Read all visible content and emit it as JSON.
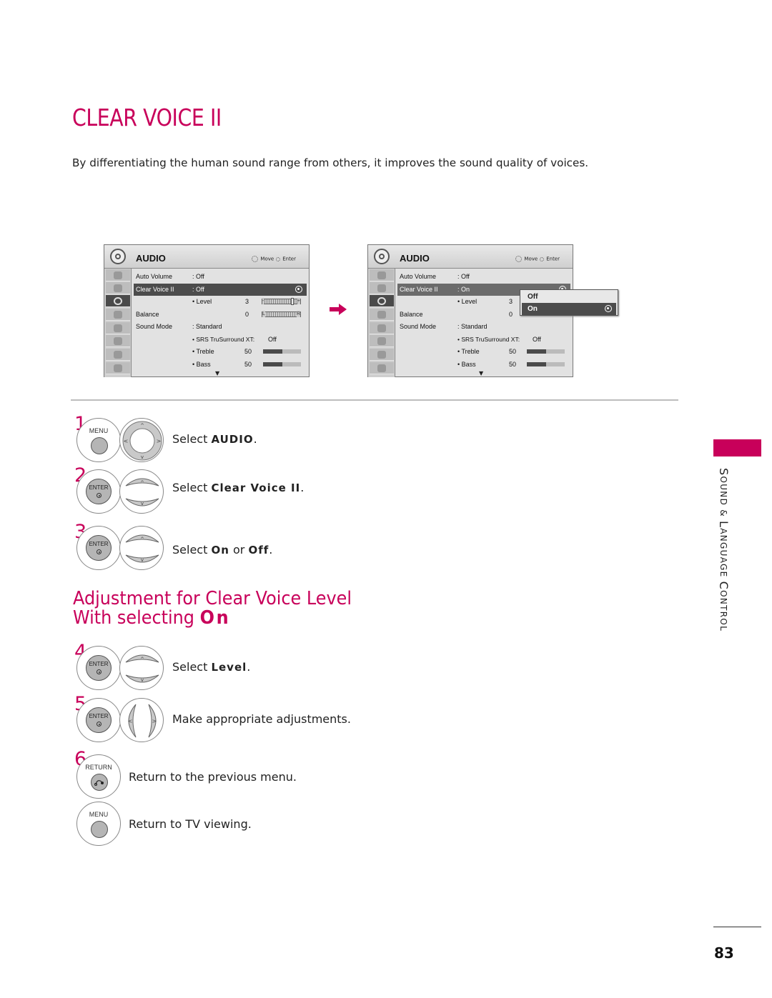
{
  "title": "CLEAR VOICE II",
  "intro": "By differentiating the human sound range from others, it improves the sound quality of voices.",
  "colors": {
    "accent": "#c8005a",
    "osd_highlight": "#4c4c4c"
  },
  "osd_before": {
    "title": "AUDIO",
    "hint_move": "Move",
    "hint_enter": "Enter",
    "rows": {
      "auto_volume": {
        "label": "Auto Volume",
        "value": ": Off"
      },
      "clear_voice": {
        "label": "Clear Voice II",
        "value": ": Off"
      },
      "level": {
        "label": "• Level",
        "value": "3",
        "slider_position": 0.75
      },
      "balance": {
        "label": "Balance",
        "value": "0",
        "slider_left": "L",
        "slider_right": "R"
      },
      "sound_mode": {
        "label": "Sound Mode",
        "value": ": Standard"
      },
      "srs": {
        "label": "• SRS TruSurround XT:",
        "value": "Off"
      },
      "treble": {
        "label": "• Treble",
        "value": "50",
        "fill": 0.5
      },
      "bass": {
        "label": "• Bass",
        "value": "50",
        "fill": 0.5
      }
    }
  },
  "osd_after": {
    "title": "AUDIO",
    "hint_move": "Move",
    "hint_enter": "Enter",
    "rows": {
      "auto_volume": {
        "label": "Auto Volume",
        "value": ": Off"
      },
      "clear_voice": {
        "label": "Clear Voice II",
        "value": ": On"
      },
      "level": {
        "label": "• Level",
        "value": "3"
      },
      "balance": {
        "label": "Balance",
        "value": "0"
      },
      "sound_mode": {
        "label": "Sound Mode",
        "value": ": Standard"
      },
      "srs": {
        "label": "• SRS TruSurround XT:",
        "value": "Off"
      },
      "treble": {
        "label": "• Treble",
        "value": "50",
        "fill": 0.5
      },
      "bass": {
        "label": "• Bass",
        "value": "50",
        "fill": 0.5
      }
    },
    "popup_options": [
      "Off",
      "On"
    ],
    "popup_selected": "On"
  },
  "remote_labels": {
    "menu": "MENU",
    "enter": "ENTER",
    "return": "RETURN"
  },
  "steps": [
    {
      "num": "1",
      "prefix": "Select ",
      "bold": "AUDIO",
      "suffix": "."
    },
    {
      "num": "2",
      "prefix": "Select ",
      "bold": "Clear Voice II",
      "suffix": "."
    },
    {
      "num": "3",
      "prefix": "Select ",
      "bold": "On",
      "middle": " or ",
      "bold2": "Off",
      "suffix": "."
    },
    {
      "num": "4",
      "prefix": "Select ",
      "bold": "Level",
      "suffix": "."
    },
    {
      "num": "5",
      "text": "Make appropriate adjustments."
    },
    {
      "num": "6",
      "text": "Return to the previous menu."
    },
    {
      "num": "",
      "text": "Return to TV viewing."
    }
  ],
  "subtitle": {
    "line1": "Adjustment for Clear Voice Level",
    "line2_prefix": "With selecting ",
    "line2_bold": "On"
  },
  "section": {
    "first": "S",
    "rest1": "OUND & ",
    "first2": "L",
    "rest2": "ANGUAGE ",
    "first3": "C",
    "rest3": "ONTROL"
  },
  "page_number": "83"
}
